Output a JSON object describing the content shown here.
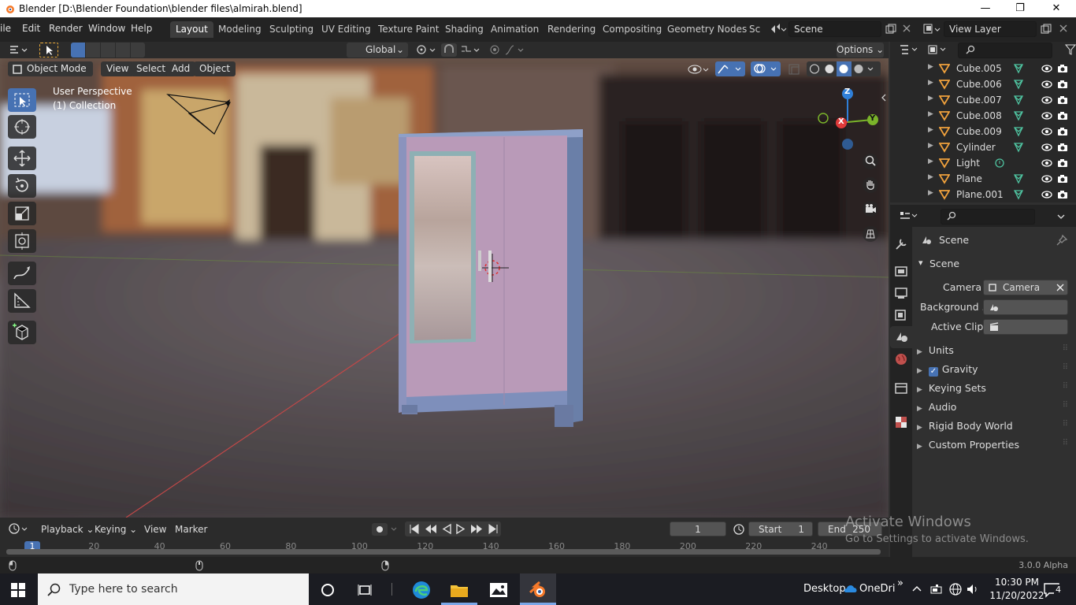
{
  "window": {
    "title": "Blender [D:\\Blender Foundation\\blender files\\almirah.blend]",
    "minimize": "—",
    "maximize": "❐",
    "close": "✕"
  },
  "menu": [
    "ile",
    "Edit",
    "Render",
    "Window",
    "Help"
  ],
  "workspaces": [
    "Layout",
    "Modeling",
    "Sculpting",
    "UV Editing",
    "Texture Paint",
    "Shading",
    "Animation",
    "Rendering",
    "Compositing",
    "Geometry Nodes",
    "Sc"
  ],
  "scene_field": "Scene",
  "view_layer_field": "View Layer",
  "toolbar": {
    "orientation": "Global",
    "options": "Options"
  },
  "viewport_header": {
    "mode": "Object Mode",
    "view": "View",
    "select": "Select",
    "add": "Add",
    "object": "Object"
  },
  "overlay": {
    "perspective": "User Perspective",
    "collection": "(1) Collection"
  },
  "gizmo": {
    "x": "X",
    "y": "Y",
    "z": "Z"
  },
  "outliner": [
    {
      "name": "Cube.005",
      "type": "mesh"
    },
    {
      "name": "Cube.006",
      "type": "mesh"
    },
    {
      "name": "Cube.007",
      "type": "mesh"
    },
    {
      "name": "Cube.008",
      "type": "mesh"
    },
    {
      "name": "Cube.009",
      "type": "mesh"
    },
    {
      "name": "Cylinder",
      "type": "mesh"
    },
    {
      "name": "Light",
      "type": "light"
    },
    {
      "name": "Plane",
      "type": "mesh"
    },
    {
      "name": "Plane.001",
      "type": "mesh"
    }
  ],
  "properties": {
    "header": "Scene",
    "panel": "Scene",
    "camera_label": "Camera",
    "camera_value": "Camera",
    "background_label": "Background ...",
    "active_clip_label": "Active Clip",
    "sections": [
      "Units",
      "Gravity",
      "Keying Sets",
      "Audio",
      "Rigid Body World",
      "Custom Properties"
    ],
    "gravity_checked": true
  },
  "timeline": {
    "playback": "Playback",
    "keying": "Keying",
    "view": "View",
    "marker": "Marker",
    "current_frame": "1",
    "start_label": "Start",
    "start_value": "1",
    "end_label": "End",
    "end_value": "250",
    "ruler": [
      "1",
      "20",
      "40",
      "60",
      "80",
      "100",
      "120",
      "140",
      "160",
      "180",
      "200",
      "220",
      "240"
    ]
  },
  "watermark": {
    "line1": "Activate Windows",
    "line2": "Go to Settings to activate Windows."
  },
  "status": {
    "version": "3.0.0 Alpha"
  },
  "taskbar": {
    "search_placeholder": "Type here to search",
    "desktop": "Desktop",
    "onedrive": "OneDriv",
    "chevron": "»",
    "time": "10:30 PM",
    "date": "11/20/2022",
    "notifications": "4"
  },
  "colors": {
    "accent": "#4772b3",
    "active_tab": "#3d3d3d",
    "header": "#232323",
    "panel": "#303030",
    "x_axis": "#e03a3a",
    "y_axis": "#7ab32a",
    "z_axis": "#2f7fd8",
    "mesh_icon": "#4fc3a0",
    "object_icon": "#f0a13c"
  }
}
